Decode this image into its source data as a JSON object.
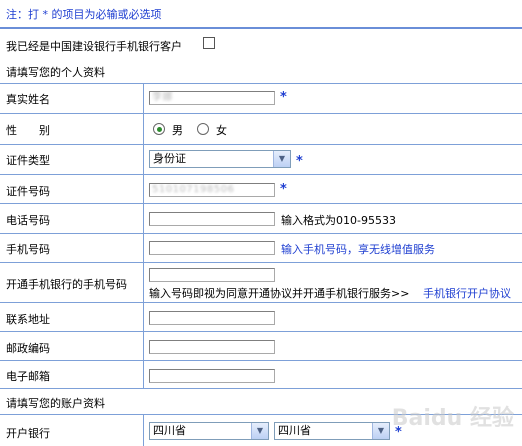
{
  "note": "注：打 * 的项目为必输或必选项",
  "customer_checkbox_label": "我已经是中国建设银行手机银行客户",
  "section_personal": "请填写您的个人资料",
  "section_account": "请填写您的账户资料",
  "required_mark": "*",
  "fields": {
    "real_name": {
      "label": "真实姓名",
      "value": "李娜"
    },
    "gender": {
      "label": "性　　别",
      "options": [
        "男",
        "女"
      ],
      "selected": "男"
    },
    "id_type": {
      "label": "证件类型",
      "selected": "身份证"
    },
    "id_number": {
      "label": "证件号码",
      "value": "510107198506"
    },
    "phone": {
      "label": "电话号码",
      "value": "",
      "hint": "输入格式为010-95533"
    },
    "mobile": {
      "label": "手机号码",
      "value": "",
      "hint": "输入手机号码，享无线增值服务"
    },
    "open_mobile": {
      "label": "开通手机银行的手机号码",
      "value": "",
      "hint": "输入号码即视为同意开通协议并开通手机银行服务>>",
      "link": "手机银行开户协议"
    },
    "address": {
      "label": "联系地址",
      "value": ""
    },
    "postcode": {
      "label": "邮政编码",
      "value": ""
    },
    "email": {
      "label": "电子邮箱",
      "value": ""
    },
    "open_bank": {
      "label": "开户银行",
      "province": "四川省",
      "city": "四川省"
    }
  },
  "watermark": "Baidu 经验",
  "colors": {
    "accent": "#1f3fd1",
    "grid": "#7da0d8"
  }
}
